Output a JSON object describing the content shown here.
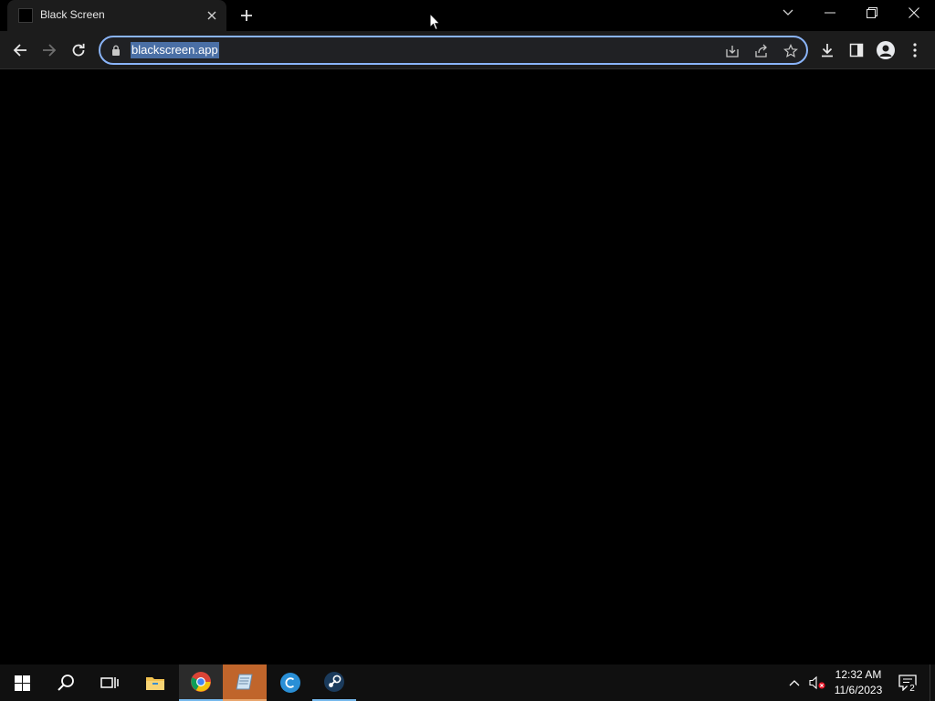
{
  "browser": {
    "tab": {
      "title": "Black Screen",
      "favicon": "black-square-icon"
    },
    "new_tab_icon": "plus-icon",
    "window_controls": [
      "tab-search-icon",
      "minimize-icon",
      "restore-icon",
      "close-icon"
    ],
    "address_bar": {
      "url": "blackscreen.app",
      "selected": true,
      "security_icon": "lock-icon"
    },
    "omnibox_icons": [
      "install-app-icon",
      "share-icon",
      "bookmark-star-icon"
    ],
    "toolbar_icons": [
      "download-icon",
      "side-panel-icon",
      "profile-icon",
      "menu-icon"
    ],
    "accent_color": "#8ab4f8"
  },
  "page": {
    "background_color": "#000000"
  },
  "taskbar": {
    "apps": [
      {
        "name": "start",
        "icon": "windows-start-icon"
      },
      {
        "name": "search",
        "icon": "search-icon"
      },
      {
        "name": "task-view",
        "icon": "task-view-icon"
      },
      {
        "name": "file-explorer",
        "icon": "folder-icon"
      },
      {
        "name": "chrome",
        "icon": "chrome-icon",
        "active": true
      },
      {
        "name": "notepad-like",
        "icon": "notebook-icon",
        "active": true
      },
      {
        "name": "app-c",
        "icon": "c-circle-icon"
      },
      {
        "name": "steam",
        "icon": "steam-icon"
      }
    ],
    "tray": {
      "icons": [
        "chevron-up-icon",
        "volume-muted-icon"
      ],
      "time": "12:32 AM",
      "date": "11/6/2023",
      "notification_count": "2"
    }
  }
}
